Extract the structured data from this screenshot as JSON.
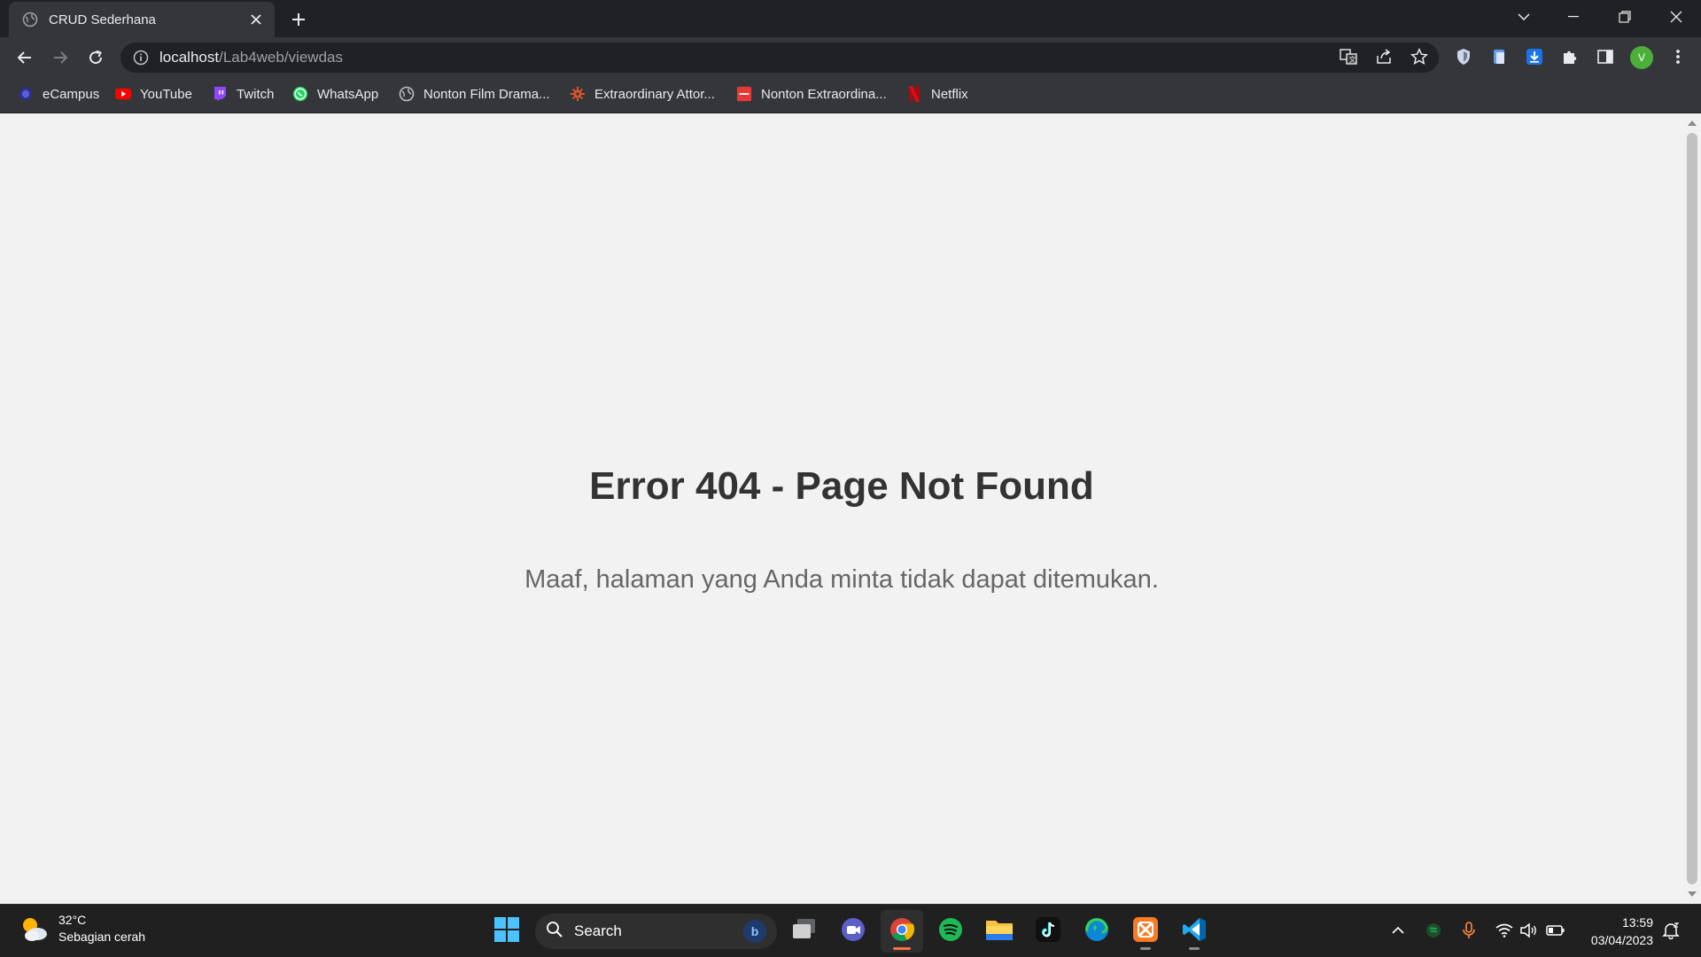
{
  "browser": {
    "tab": {
      "title": "CRUD Sederhana"
    },
    "address_bar": {
      "host": "localhost",
      "path": "/Lab4web/viewdas"
    },
    "bookmarks": [
      {
        "label": "eCampus",
        "icon": "ecampus-icon"
      },
      {
        "label": "YouTube",
        "icon": "youtube-icon"
      },
      {
        "label": "Twitch",
        "icon": "twitch-icon"
      },
      {
        "label": "WhatsApp",
        "icon": "whatsapp-icon"
      },
      {
        "label": "Nonton Film Drama...",
        "icon": "globe-icon"
      },
      {
        "label": "Extraordinary Attor...",
        "icon": "site-icon"
      },
      {
        "label": "Nonton Extraordina...",
        "icon": "site-red-icon"
      },
      {
        "label": "Netflix",
        "icon": "netflix-icon"
      }
    ],
    "profile_initial": "V"
  },
  "page": {
    "heading": "Error 404 - Page Not Found",
    "message": "Maaf, halaman yang Anda minta tidak dapat ditemukan."
  },
  "taskbar": {
    "weather": {
      "temperature": "32°C",
      "condition": "Sebagian cerah"
    },
    "search_label": "Search",
    "clock": {
      "time": "13:59",
      "date": "03/04/2023"
    }
  },
  "colors": {
    "page_background": "#f2f2f2",
    "heading": "#333333",
    "message": "#666666",
    "chrome_dark": "#202124",
    "chrome_toolbar": "#35363a",
    "taskbar": "#202020"
  }
}
